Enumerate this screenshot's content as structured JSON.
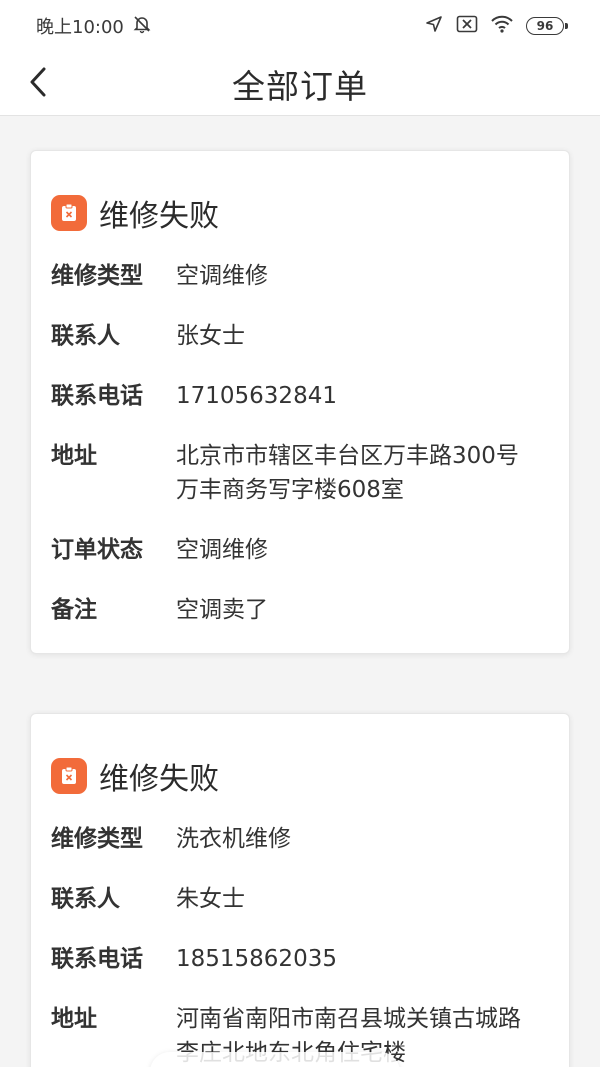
{
  "status_bar": {
    "time": "晚上10:00",
    "battery": "96",
    "icons": [
      "alarm-off-icon",
      "location-icon",
      "sim-off-icon",
      "wifi-icon"
    ]
  },
  "header": {
    "title": "全部订单",
    "back_icon": "chevron-left-icon"
  },
  "orders": [
    {
      "status": "维修失败",
      "fields": [
        {
          "label": "维修类型",
          "value": "空调维修"
        },
        {
          "label": "联系人",
          "value": "张女士"
        },
        {
          "label": "联系电话",
          "value": "17105632841"
        },
        {
          "label": "地址",
          "value_lines": [
            "北京市市辖区丰台区万丰路300号",
            "万丰商务写字楼608室"
          ]
        },
        {
          "label": "订单状态",
          "value": "空调维修"
        },
        {
          "label": "备注",
          "value": "空调卖了"
        }
      ]
    },
    {
      "status": "维修失败",
      "fields": [
        {
          "label": "维修类型",
          "value": "洗衣机维修"
        },
        {
          "label": "联系人",
          "value": "朱女士"
        },
        {
          "label": "联系电话",
          "value": "18515862035"
        },
        {
          "label": "地址",
          "value_lines": [
            "河南省南阳市南召县城关镇古城路",
            "李庄北地东北角住宅楼"
          ]
        }
      ]
    }
  ],
  "colors": {
    "accent": "#f26b3a",
    "background": "#f4f4f4",
    "card": "#ffffff"
  }
}
